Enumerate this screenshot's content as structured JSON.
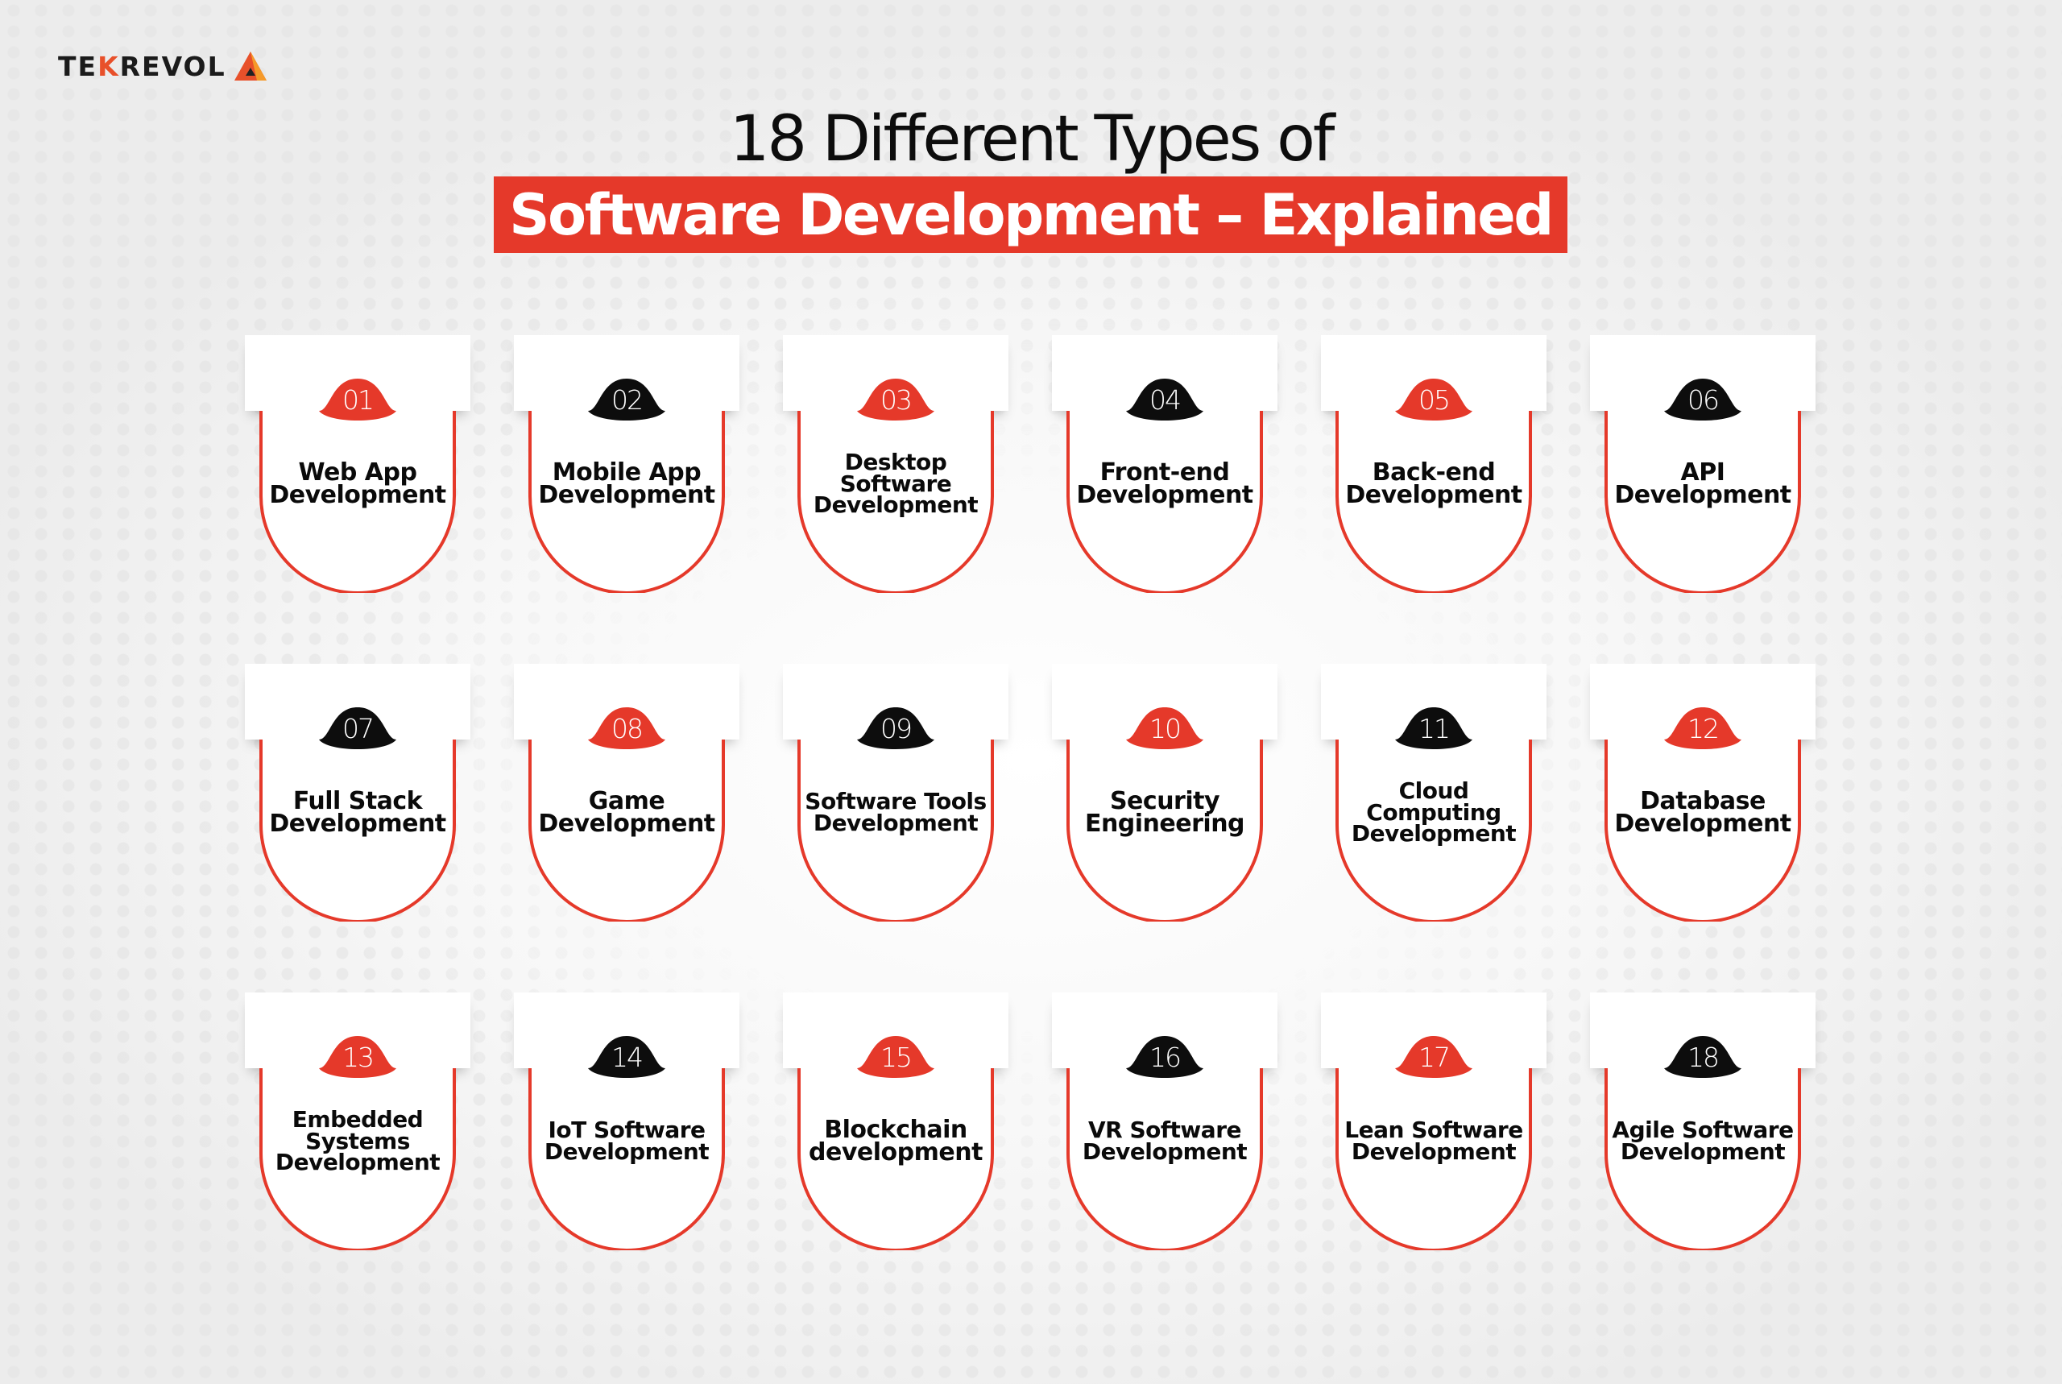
{
  "brand": {
    "name_part1": "TE",
    "name_k": "K",
    "name_part2": "REVOL",
    "accent": "#e8502a"
  },
  "title": {
    "line1": "18 Different Types of",
    "line2": "Software Development – Explained"
  },
  "colors": {
    "red": "#e5392a",
    "black": "#0d0d0d"
  },
  "items": [
    {
      "num": "01",
      "label": "Web App\nDevelopment",
      "color": "red"
    },
    {
      "num": "02",
      "label": "Mobile App\nDevelopment",
      "color": "black"
    },
    {
      "num": "03",
      "label": "Desktop\nSoftware\nDevelopment",
      "color": "red"
    },
    {
      "num": "04",
      "label": "Front-end\nDevelopment",
      "color": "black"
    },
    {
      "num": "05",
      "label": "Back-end\nDevelopment",
      "color": "red"
    },
    {
      "num": "06",
      "label": "API\nDevelopment",
      "color": "black"
    },
    {
      "num": "07",
      "label": "Full Stack\nDevelopment",
      "color": "black"
    },
    {
      "num": "08",
      "label": "Game\nDevelopment",
      "color": "red"
    },
    {
      "num": "09",
      "label": "Software Tools\nDevelopment",
      "color": "black"
    },
    {
      "num": "10",
      "label": "Security\nEngineering",
      "color": "red"
    },
    {
      "num": "11",
      "label": "Cloud\nComputing\nDevelopment",
      "color": "black"
    },
    {
      "num": "12",
      "label": "Database\nDevelopment",
      "color": "red"
    },
    {
      "num": "13",
      "label": "Embedded\nSystems\nDevelopment",
      "color": "red"
    },
    {
      "num": "14",
      "label": "IoT Software\nDevelopment",
      "color": "black"
    },
    {
      "num": "15",
      "label": "Blockchain\ndevelopment",
      "color": "red"
    },
    {
      "num": "16",
      "label": "VR Software\nDevelopment",
      "color": "black"
    },
    {
      "num": "17",
      "label": "Lean Software\nDevelopment",
      "color": "red"
    },
    {
      "num": "18",
      "label": "Agile Software\nDevelopment",
      "color": "black"
    }
  ]
}
